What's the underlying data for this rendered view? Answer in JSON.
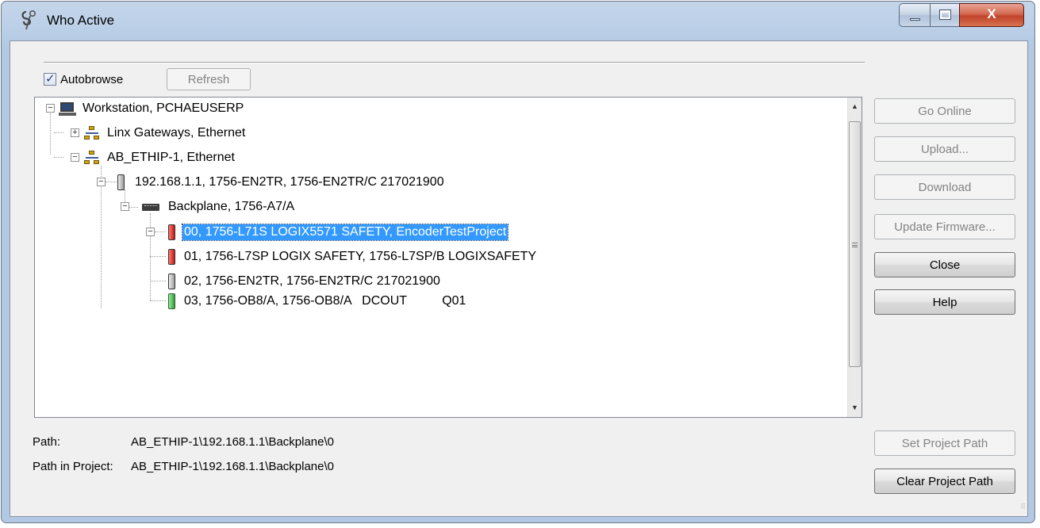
{
  "window": {
    "title": "Who Active",
    "controls": {
      "minimize": "minimize",
      "maximize": "maximize",
      "close": "X"
    }
  },
  "autobrowse": {
    "label": "Autobrowse",
    "checked": true
  },
  "refresh_label": "Refresh",
  "tree": {
    "workstation": "Workstation, PCHAEUSERP",
    "linx": "Linx Gateways, Ethernet",
    "ethip": "AB_ETHIP-1, Ethernet",
    "en2tr": "192.168.1.1, 1756-EN2TR, 1756-EN2TR/C 217021900",
    "backplane": "Backplane, 1756-A7/A",
    "slot0": "00, 1756-L71S LOGIX5571 SAFETY, EncoderTestProject",
    "slot1": "01, 1756-L7SP LOGIX SAFETY, 1756-L7SP/B LOGIXSAFETY",
    "slot2": "02, 1756-EN2TR, 1756-EN2TR/C 217021900",
    "slot3": "03, 1756-OB8/A, 1756-OB8/A   DCOUT          Q01"
  },
  "buttons": {
    "go_online": "Go Online",
    "upload": "Upload...",
    "download": "Download",
    "update_firmware": "Update Firmware...",
    "close": "Close",
    "help": "Help",
    "set_project_path": "Set Project Path",
    "clear_project_path": "Clear Project Path"
  },
  "paths": {
    "path_label": "Path:",
    "path_value": "AB_ETHIP-1\\192.168.1.1\\Backplane\\0",
    "project_label": "Path in Project:",
    "project_value": "AB_ETHIP-1\\192.168.1.1\\Backplane\\0"
  },
  "colors": {
    "selection": "#3399ff",
    "safety_module": "#d42a2a",
    "io_module": "#3cb84a",
    "comm_module": "#c9c9c9"
  }
}
